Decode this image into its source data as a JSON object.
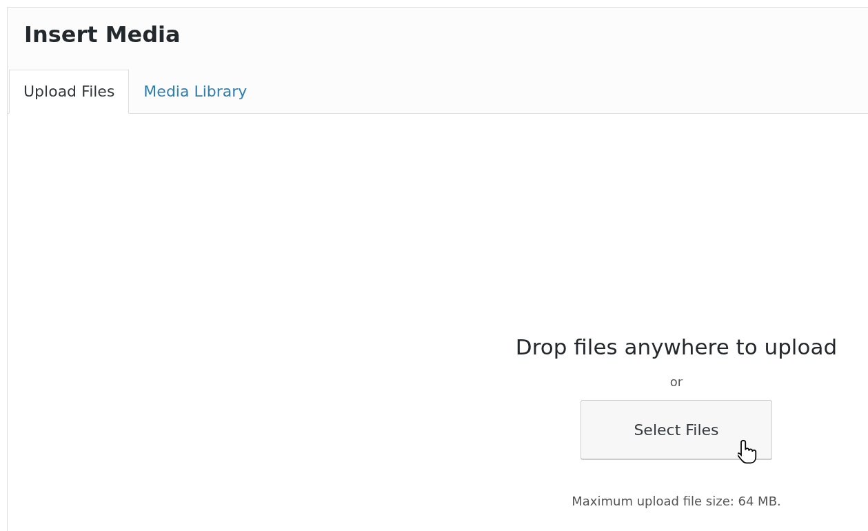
{
  "window": {
    "title": "Insert Media"
  },
  "tabs": [
    {
      "label": "Upload Files",
      "selected": true
    },
    {
      "label": "Media Library",
      "selected": false
    }
  ],
  "uploader": {
    "instructions": "Drop files anywhere to upload",
    "separator": "or",
    "button": "Select Files",
    "max_size": "Maximum upload file size: 64 MB."
  }
}
